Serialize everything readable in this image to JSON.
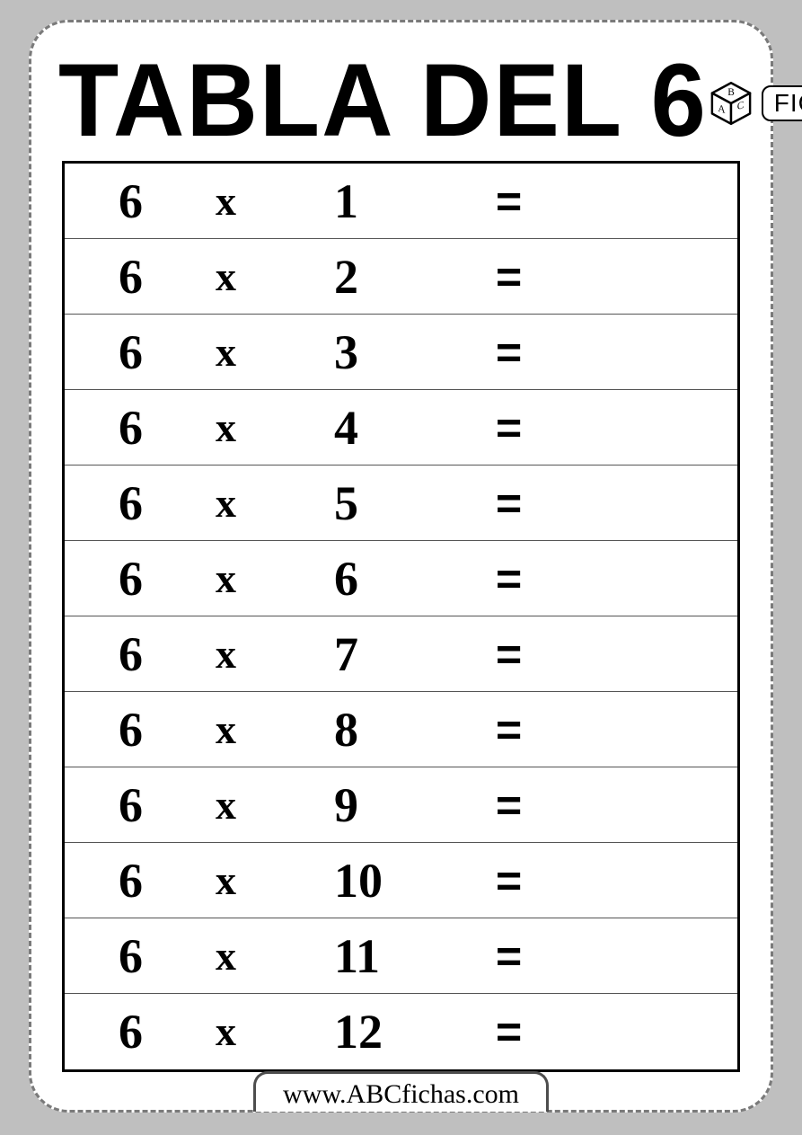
{
  "header": {
    "title": "TABLA DEL 6",
    "logo": {
      "cube_letters": [
        "B",
        "A",
        "C"
      ],
      "label": "FICHAS"
    }
  },
  "table": {
    "operator": "x",
    "equals": "=",
    "rows": [
      {
        "a": "6",
        "b": "1",
        "answer": ""
      },
      {
        "a": "6",
        "b": "2",
        "answer": ""
      },
      {
        "a": "6",
        "b": "3",
        "answer": ""
      },
      {
        "a": "6",
        "b": "4",
        "answer": ""
      },
      {
        "a": "6",
        "b": "5",
        "answer": ""
      },
      {
        "a": "6",
        "b": "6",
        "answer": ""
      },
      {
        "a": "6",
        "b": "7",
        "answer": ""
      },
      {
        "a": "6",
        "b": "8",
        "answer": ""
      },
      {
        "a": "6",
        "b": "9",
        "answer": ""
      },
      {
        "a": "6",
        "b": "10",
        "answer": ""
      },
      {
        "a": "6",
        "b": "11",
        "answer": ""
      },
      {
        "a": "6",
        "b": "12",
        "answer": ""
      }
    ]
  },
  "footer": {
    "url": "www.ABCfichas.com"
  }
}
